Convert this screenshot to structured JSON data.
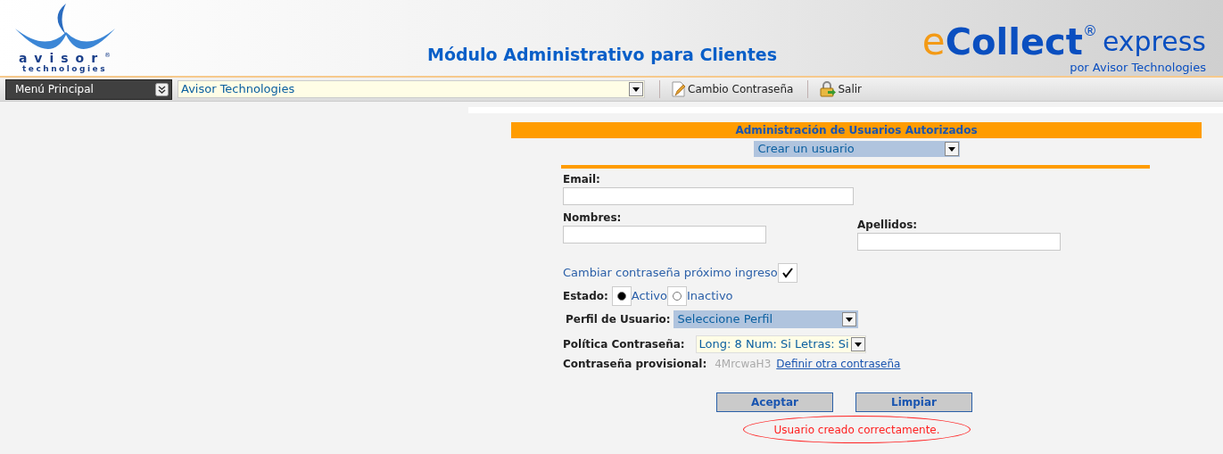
{
  "header": {
    "brand": {
      "name": "avisor",
      "sub": "technologies",
      "mark": "®"
    },
    "title": "Módulo Administrativo para Clientes",
    "product": {
      "prefix": "e",
      "name": "Collect",
      "mark": "®",
      "edition": "express",
      "byline": "por Avisor Technologies"
    }
  },
  "toolbar": {
    "menu": "Menú Principal",
    "company": "Avisor Technologies",
    "actions": [
      {
        "label": "Cambio Contraseña",
        "kind": "edit"
      },
      {
        "label": "Salir",
        "kind": "lock"
      }
    ]
  },
  "panel": {
    "title": "Administración de Usuarios Autorizados",
    "action": "Crear un usuario",
    "fields": [
      {
        "label": "Email:"
      },
      {
        "label": "Nombres:"
      },
      {
        "label": "Apellidos:"
      }
    ],
    "change_password": {
      "label": "Cambiar contraseña próximo ingreso",
      "checked": true
    },
    "status": {
      "label": "Estado:",
      "options": [
        {
          "label": "Activo",
          "selected": true
        },
        {
          "label": "Inactivo",
          "selected": false
        }
      ]
    },
    "profile": {
      "label": "Perfil de Usuario:",
      "value": "Seleccione Perfil"
    },
    "policy": {
      "label": "Política Contraseña:",
      "value": "Long: 8 Num: Si Letras: Si"
    },
    "temp_password": {
      "label": "Contraseña provisional:",
      "value": "4MrcwaH3",
      "link": "Definir otra contraseña"
    },
    "buttons": [
      "Aceptar",
      "Limpiar"
    ],
    "message": {
      "text": "Usuario creado correctamente.",
      "highlighted": true
    }
  }
}
